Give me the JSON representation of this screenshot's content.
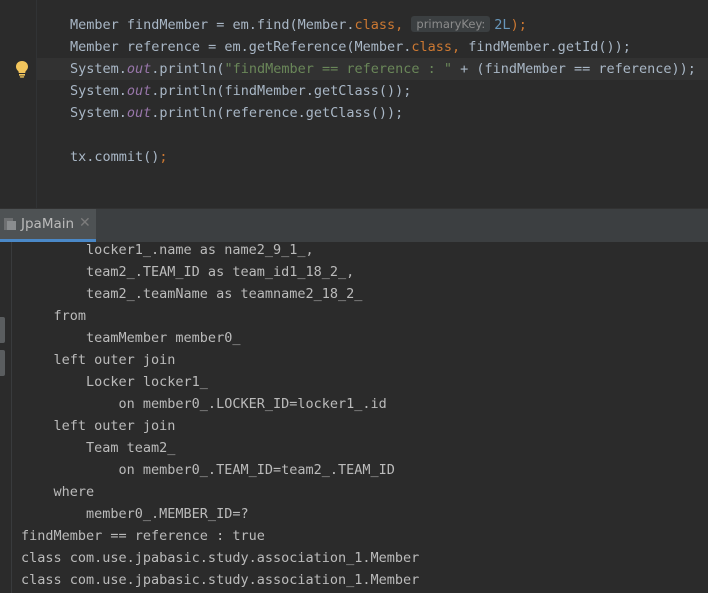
{
  "editor": {
    "lines": [
      {
        "id": "l1",
        "segments": [
          {
            "t": "Member findMember = em.find(Member.",
            "c": ""
          },
          {
            "t": "class",
            "c": "kw"
          },
          {
            "t": ", ",
            "c": "kw"
          },
          {
            "t": "primaryKey:",
            "c": "hint"
          },
          {
            "t": "2L",
            "c": "num"
          },
          {
            "t": ");",
            "c": "kw"
          }
        ]
      },
      {
        "id": "l2",
        "segments": [
          {
            "t": "Member reference = em.getReference(Member.",
            "c": ""
          },
          {
            "t": "class",
            "c": "kw"
          },
          {
            "t": ", ",
            "c": "kw"
          },
          {
            "t": "findMember.getId());",
            "c": ""
          }
        ]
      },
      {
        "id": "l3",
        "segments": [
          {
            "t": "System.",
            "c": ""
          },
          {
            "t": "out",
            "c": "fld"
          },
          {
            "t": ".println(",
            "c": ""
          },
          {
            "t": "\"findMember == reference : \"",
            "c": "str"
          },
          {
            "t": " + (findMember == reference));",
            "c": ""
          }
        ]
      },
      {
        "id": "l4",
        "segments": [
          {
            "t": "System.",
            "c": ""
          },
          {
            "t": "out",
            "c": "fld"
          },
          {
            "t": ".println(findMember.getClass());",
            "c": ""
          }
        ]
      },
      {
        "id": "l5",
        "segments": [
          {
            "t": "System.",
            "c": ""
          },
          {
            "t": "out",
            "c": "fld"
          },
          {
            "t": ".println(reference.getClass());",
            "c": ""
          }
        ]
      },
      {
        "id": "l6",
        "segments": []
      },
      {
        "id": "l7",
        "segments": [
          {
            "t": "tx.commit()",
            "c": ""
          },
          {
            "t": ";",
            "c": "kw"
          }
        ]
      }
    ],
    "gutter_icon": "lightbulb-icon"
  },
  "run_panel": {
    "tab_label": "JpaMain",
    "tab_icon": "run-config-icon",
    "close_icon": "close-icon",
    "close_glyph": "✕"
  },
  "console": {
    "lines": [
      "        locker1_.name as name2_9_1_,",
      "        team2_.TEAM_ID as team_id1_18_2_,",
      "        team2_.teamName as teamname2_18_2_",
      "    from",
      "        teamMember member0_",
      "    left outer join",
      "        Locker locker1_",
      "            on member0_.LOCKER_ID=locker1_.id",
      "    left outer join",
      "        Team team2_",
      "            on member0_.TEAM_ID=team2_.TEAM_ID",
      "    where",
      "        member0_.MEMBER_ID=?",
      "findMember == reference : true",
      "class com.use.jpabasic.study.association_1.Member",
      "class com.use.jpabasic.study.association_1.Member"
    ]
  },
  "colors": {
    "background": "#2b2b2b",
    "keyword": "#cc7832",
    "string": "#6a8759",
    "number": "#6897bb",
    "field": "#9876aa",
    "tab_underline": "#4a88c7"
  }
}
